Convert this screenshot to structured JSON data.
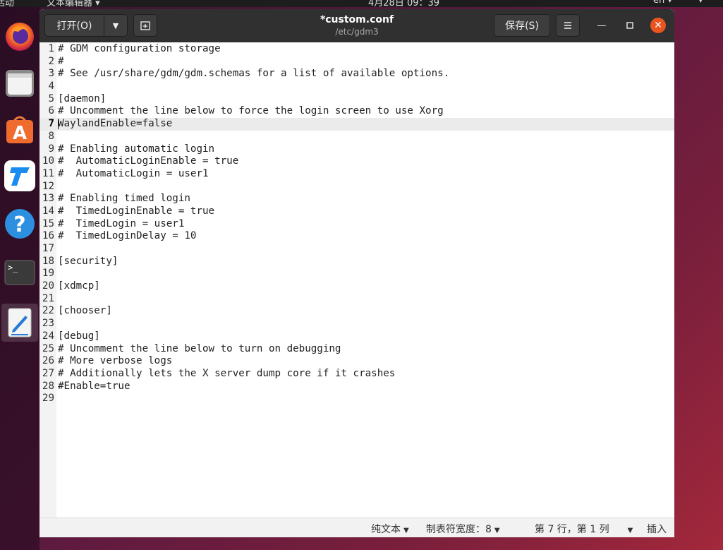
{
  "topbar": {
    "activities": "活动",
    "app_menu": "文本编辑器 ▾",
    "clock": "4月28日 09：39",
    "lang": "en ▾"
  },
  "dock": {
    "apps": [
      {
        "name": "firefox-icon"
      },
      {
        "name": "files-icon"
      },
      {
        "name": "software-center-icon"
      },
      {
        "name": "todesk-icon"
      },
      {
        "name": "help-icon"
      },
      {
        "name": "terminal-icon"
      },
      {
        "name": "text-editor-icon"
      }
    ]
  },
  "window": {
    "open_label": "打开(O)",
    "title": "*custom.conf",
    "subtitle": "/etc/gdm3",
    "save_label": "保存(S)"
  },
  "editor": {
    "current_line": 7,
    "lines": [
      "# GDM configuration storage",
      "#",
      "# See /usr/share/gdm/gdm.schemas for a list of available options.",
      "",
      "[daemon]",
      "# Uncomment the line below to force the login screen to use Xorg",
      "WaylandEnable=false",
      "",
      "# Enabling automatic login",
      "#  AutomaticLoginEnable = true",
      "#  AutomaticLogin = user1",
      "",
      "# Enabling timed login",
      "#  TimedLoginEnable = true",
      "#  TimedLogin = user1",
      "#  TimedLoginDelay = 10",
      "",
      "[security]",
      "",
      "[xdmcp]",
      "",
      "[chooser]",
      "",
      "[debug]",
      "# Uncomment the line below to turn on debugging",
      "# More verbose logs",
      "# Additionally lets the X server dump core if it crashes",
      "#Enable=true",
      ""
    ]
  },
  "statusbar": {
    "language": "纯文本",
    "tab_width": "制表符宽度：8",
    "position": "第 7 行，第 1 列",
    "mode": "插入"
  }
}
